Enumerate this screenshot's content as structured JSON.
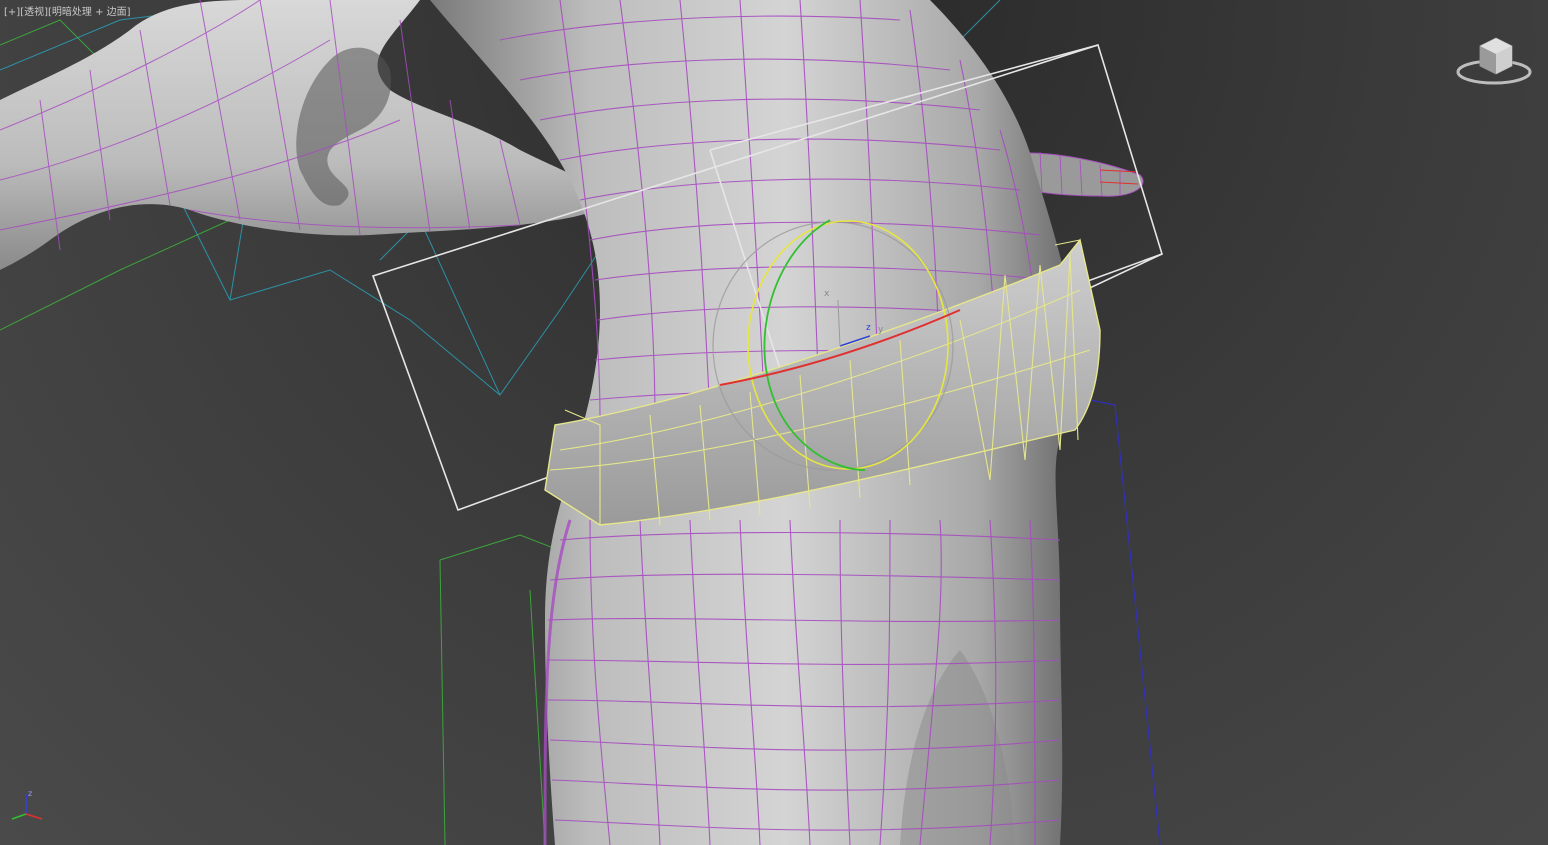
{
  "viewport": {
    "label_plus": "[+]",
    "label_view": "[透视]",
    "label_shading": "[明暗处理 + 边面]"
  },
  "scene": {
    "mesh_wire_color": "#a64cc0",
    "belt_wire_color": "#e6e68c",
    "bone_color": "#2aa0b8",
    "helper_green": "#3cb43c",
    "helper_blue": "#3030c8",
    "selection_box_color": "#e6e6e6",
    "gizmo_x_color": "#e03030",
    "gizmo_y_color": "#30c030",
    "gizmo_z_color": "#3040e0",
    "gizmo_screen_color": "#e6e640",
    "gizmo_labels": {
      "x": "x",
      "z": "z",
      "y": "y"
    }
  },
  "viewcube": {
    "icon": "viewcube-icon"
  },
  "axis_tripod": {
    "icon": "axis-tripod-icon",
    "z_label": "z"
  }
}
